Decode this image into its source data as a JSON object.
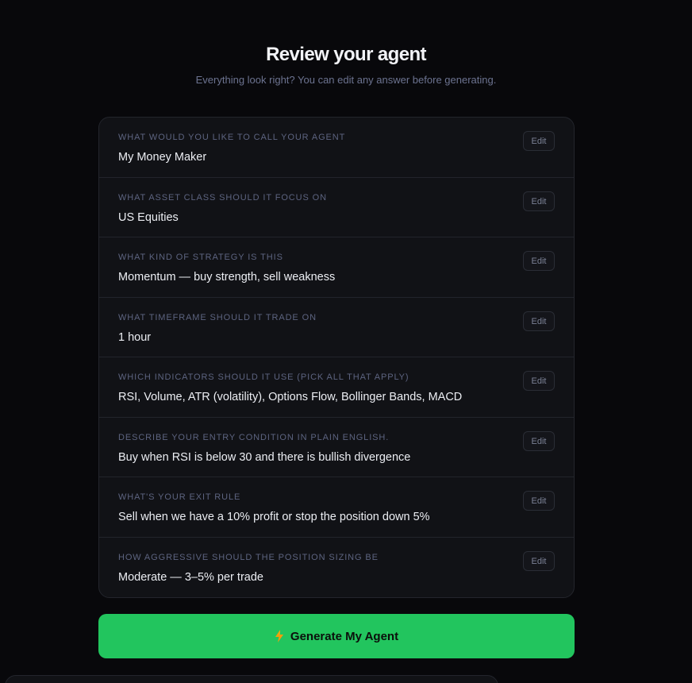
{
  "header": {
    "title": "Review your agent",
    "subtitle": "Everything look right? You can edit any answer before generating."
  },
  "answers": [
    {
      "label": "WHAT WOULD YOU LIKE TO CALL YOUR AGENT",
      "value": "My Money Maker",
      "edit_label": "Edit"
    },
    {
      "label": "WHAT ASSET CLASS SHOULD IT FOCUS ON",
      "value": "US Equities",
      "edit_label": "Edit"
    },
    {
      "label": "WHAT KIND OF STRATEGY IS THIS",
      "value": "Momentum — buy strength, sell weakness",
      "edit_label": "Edit"
    },
    {
      "label": "WHAT TIMEFRAME SHOULD IT TRADE ON",
      "value": "1 hour",
      "edit_label": "Edit"
    },
    {
      "label": "WHICH INDICATORS SHOULD IT USE (PICK ALL THAT APPLY)",
      "value": "RSI, Volume, ATR (volatility), Options Flow, Bollinger Bands, MACD",
      "edit_label": "Edit"
    },
    {
      "label": "DESCRIBE YOUR ENTRY CONDITION IN PLAIN ENGLISH.",
      "value": "Buy when RSI is below 30 and there is bullish divergence",
      "edit_label": "Edit"
    },
    {
      "label": "WHAT'S YOUR EXIT RULE",
      "value": "Sell when we have a 10% profit or stop the position down 5%",
      "edit_label": "Edit"
    },
    {
      "label": "HOW AGGRESSIVE SHOULD THE POSITION SIZING BE",
      "value": "Moderate — 3–5% per trade",
      "edit_label": "Edit"
    }
  ],
  "actions": {
    "generate_label": "Generate My Agent",
    "generate_icon": "lightning-bolt-icon"
  },
  "colors": {
    "background": "#08080b",
    "card": "#111216",
    "accent_green": "#22c55e",
    "bolt_orange": "#f59e0b"
  }
}
